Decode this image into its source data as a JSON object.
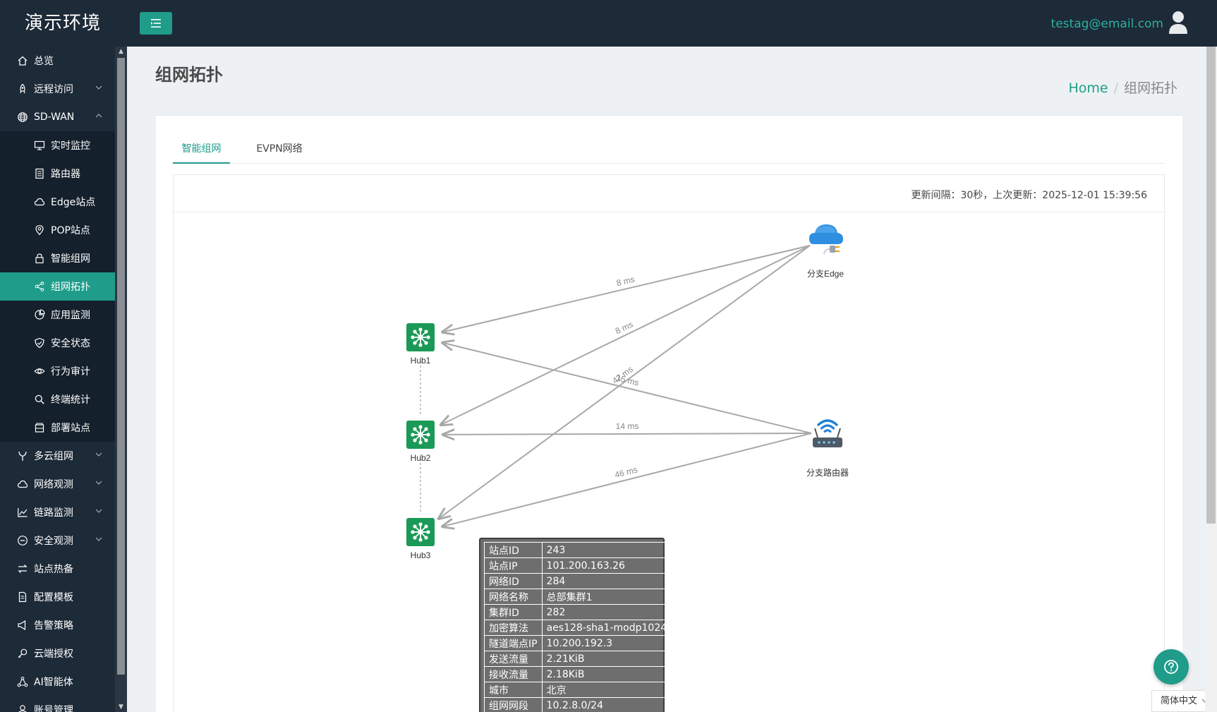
{
  "app": {
    "brand": "演示环境",
    "menu_toggle_icon": "menu-icon"
  },
  "user": {
    "email": "testag@email.com",
    "avatar_icon": "user-icon"
  },
  "sidebar": {
    "items": [
      {
        "label": "总览",
        "icon": "home-icon"
      },
      {
        "label": "远程访问",
        "icon": "rocket-icon",
        "caret": "down"
      },
      {
        "label": "SD-WAN",
        "icon": "globe-icon",
        "caret": "up",
        "expanded": true,
        "children": [
          {
            "label": "实时监控",
            "icon": "monitor-icon"
          },
          {
            "label": "路由器",
            "icon": "router-icon"
          },
          {
            "label": "Edge站点",
            "icon": "cloud-icon"
          },
          {
            "label": "POP站点",
            "icon": "location-icon"
          },
          {
            "label": "智能组网",
            "icon": "lock-icon"
          },
          {
            "label": "组网拓扑",
            "icon": "share-icon",
            "active": true
          },
          {
            "label": "应用监测",
            "icon": "pie-icon"
          },
          {
            "label": "安全状态",
            "icon": "shield-icon"
          },
          {
            "label": "行为审计",
            "icon": "eye-icon"
          },
          {
            "label": "终端统计",
            "icon": "search-icon"
          },
          {
            "label": "部署站点",
            "icon": "box-icon"
          }
        ]
      },
      {
        "label": "多云组网",
        "icon": "fork-icon",
        "caret": "down"
      },
      {
        "label": "网络观测",
        "icon": "cloud-icon",
        "caret": "down"
      },
      {
        "label": "链路监测",
        "icon": "line-chart-icon",
        "caret": "down"
      },
      {
        "label": "安全观测",
        "icon": "minus-circle-icon",
        "caret": "down"
      },
      {
        "label": "站点热备",
        "icon": "swap-icon"
      },
      {
        "label": "配置模板",
        "icon": "file-icon"
      },
      {
        "label": "告警策略",
        "icon": "alert-icon"
      },
      {
        "label": "云端授权",
        "icon": "key-icon"
      },
      {
        "label": "AI智能体",
        "icon": "ai-icon"
      },
      {
        "label": "账号管理",
        "icon": "user-icon"
      }
    ]
  },
  "page": {
    "title": "组网拓扑"
  },
  "breadcrumb": {
    "home": "Home",
    "separator": "/",
    "current": "组网拓扑"
  },
  "tabs": [
    {
      "label": "智能组网",
      "active": true
    },
    {
      "label": "EVPN网络",
      "active": false
    }
  ],
  "update_info": "更新间隔：30秒，上次更新：2025-12-01 15:39:56",
  "topology": {
    "nodes": {
      "hub1": {
        "label": "Hub1",
        "icon": "hub-icon"
      },
      "hub2": {
        "label": "Hub2",
        "icon": "hub-icon"
      },
      "hub3": {
        "label": "Hub3",
        "icon": "hub-icon"
      },
      "edge": {
        "label": "分支Edge",
        "icon": "cloud-plug-icon"
      },
      "router": {
        "label": "分支路由器",
        "icon": "wifi-router-icon"
      }
    },
    "links": [
      {
        "from": "edge",
        "to": "hub1",
        "latency": "8 ms"
      },
      {
        "from": "edge",
        "to": "hub2",
        "latency": "8 ms"
      },
      {
        "from": "edge",
        "to": "hub3",
        "latency": "42 ms"
      },
      {
        "from": "router",
        "to": "hub1",
        "latency": "15 ms"
      },
      {
        "from": "router",
        "to": "hub2",
        "latency": "14 ms"
      },
      {
        "from": "router",
        "to": "hub3",
        "latency": "46 ms"
      }
    ],
    "hub_chain": [
      "hub1",
      "hub2",
      "hub3"
    ]
  },
  "tooltip": {
    "rows": [
      {
        "key": "站点ID",
        "value": "243"
      },
      {
        "key": "站点IP",
        "value": "101.200.163.26"
      },
      {
        "key": "网络ID",
        "value": "284"
      },
      {
        "key": "网络名称",
        "value": "总部集群1"
      },
      {
        "key": "集群ID",
        "value": "282"
      },
      {
        "key": "加密算法",
        "value": "aes128-sha1-modp1024"
      },
      {
        "key": "隧道端点IP",
        "value": "10.200.192.3"
      },
      {
        "key": "发送流量",
        "value": "2.21KiB"
      },
      {
        "key": "接收流量",
        "value": "2.18KiB"
      },
      {
        "key": "城市",
        "value": "北京"
      },
      {
        "key": "组网网段",
        "value": "10.2.8.0/24"
      }
    ]
  },
  "help": {
    "icon": "question-icon"
  },
  "language": {
    "selected": "简体中文"
  },
  "colors": {
    "accent": "#1f9c8a",
    "nav_bg": "#1d2a38",
    "hub_green": "#1a9a56",
    "edge_blue": "#2e8fe0"
  }
}
